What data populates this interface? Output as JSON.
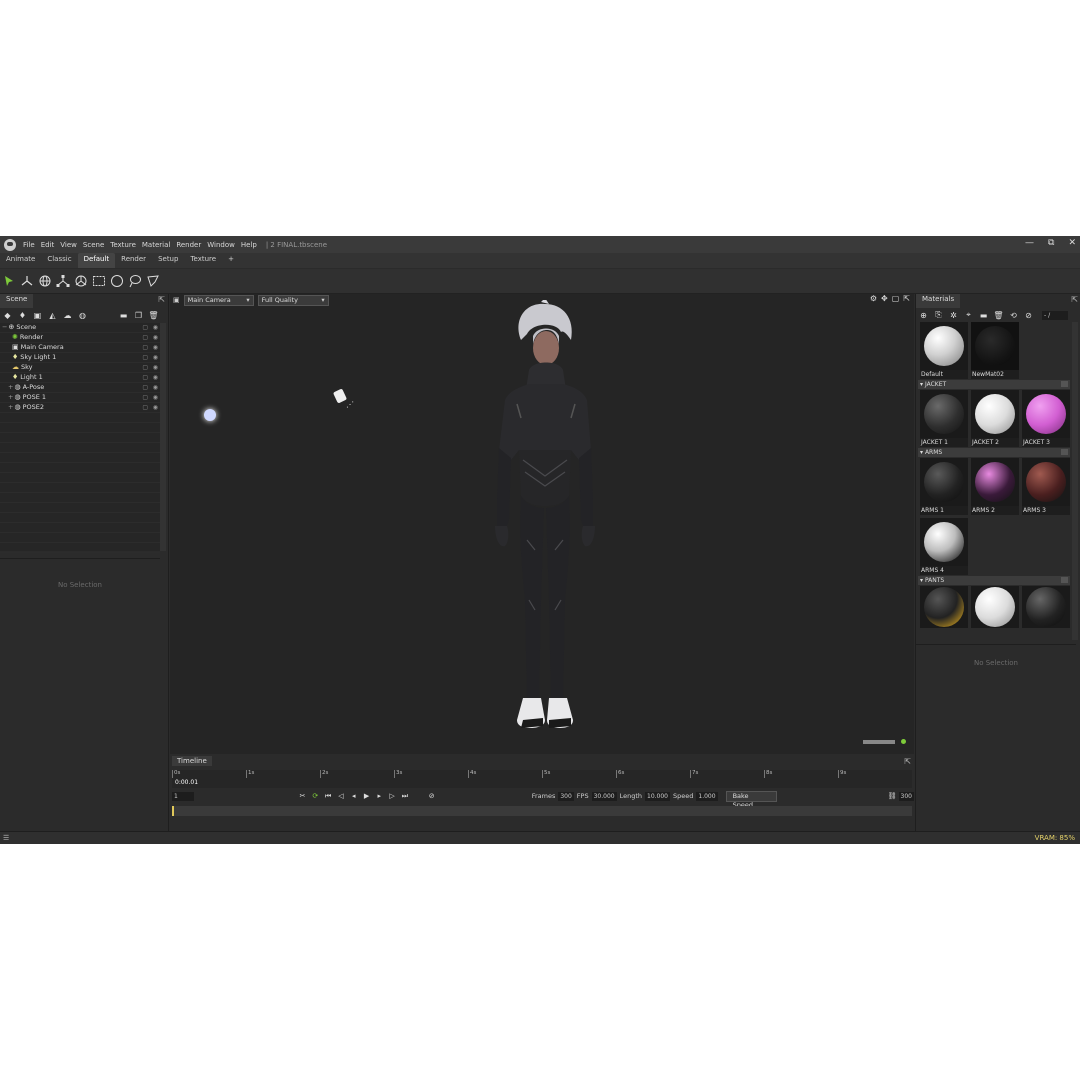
{
  "menubar": {
    "items": [
      "File",
      "Edit",
      "View",
      "Scene",
      "Texture",
      "Material",
      "Render",
      "Window",
      "Help"
    ],
    "file_title": "| 2 FINAL.tbscene",
    "controls": [
      "—",
      "⧉",
      "✕"
    ]
  },
  "layout_tabs": [
    "Animate",
    "Classic",
    "Default",
    "Render",
    "Setup",
    "Texture",
    "+"
  ],
  "scene_panel": {
    "tab": "Scene",
    "items": [
      {
        "label": "Scene",
        "icon": "⊕"
      },
      {
        "label": "Render",
        "icon": "✺"
      },
      {
        "label": "Main Camera",
        "icon": "▣"
      },
      {
        "label": "Sky Light 1",
        "icon": "♦"
      },
      {
        "label": "Sky",
        "icon": "☁"
      },
      {
        "label": "Light 1",
        "icon": "♦"
      },
      {
        "label": "A-Pose",
        "icon": "◍"
      },
      {
        "label": "POSE 1",
        "icon": "◍"
      },
      {
        "label": "POSE2",
        "icon": "◍"
      }
    ],
    "no_selection": "No Selection"
  },
  "viewport": {
    "camera": "Main Camera",
    "quality": "Full Quality"
  },
  "materials_panel": {
    "tab": "Materials",
    "search": "- /",
    "top": [
      {
        "name": "Default",
        "color": "#e8e8e8"
      },
      {
        "name": "NewMat02",
        "color": "#1a1a1a"
      }
    ],
    "groups": [
      {
        "name": "JACKET",
        "items": [
          {
            "name": "JACKET 1",
            "color": "#3a3a3a"
          },
          {
            "name": "JACKET 2",
            "color": "#e2e2e2"
          },
          {
            "name": "JACKET 3",
            "color": "#d25fd2"
          }
        ]
      },
      {
        "name": "ARMS",
        "items": [
          {
            "name": "ARMS 1",
            "color": "#2a2a2a"
          },
          {
            "name": "ARMS 2",
            "color": "#c046b8"
          },
          {
            "name": "ARMS 3",
            "color": "#6a2a2a"
          },
          {
            "name": "ARMS 4",
            "color": "#cfcfcf"
          }
        ]
      },
      {
        "name": "PANTS",
        "items": [
          {
            "name": "",
            "color": "#333333"
          },
          {
            "name": "",
            "color": "#e4e4e4"
          },
          {
            "name": "",
            "color": "#2a2a2a"
          }
        ]
      }
    ],
    "no_selection": "No Selection"
  },
  "timeline": {
    "tab": "Timeline",
    "ticks": [
      "0s",
      "1s",
      "2s",
      "3s",
      "4s",
      "5s",
      "6s",
      "7s",
      "8s",
      "9s"
    ],
    "current_time": "0:00.01",
    "frame": "1",
    "frames_label": "Frames",
    "frames": "300",
    "fps_label": "FPS",
    "fps": "30.000",
    "length_label": "Length",
    "length": "10.000",
    "speed_label": "Speed",
    "speed": "1.000",
    "bake_label": "Bake Speed",
    "end_frame": "300"
  },
  "status": {
    "vram": "VRAM: 85%"
  }
}
